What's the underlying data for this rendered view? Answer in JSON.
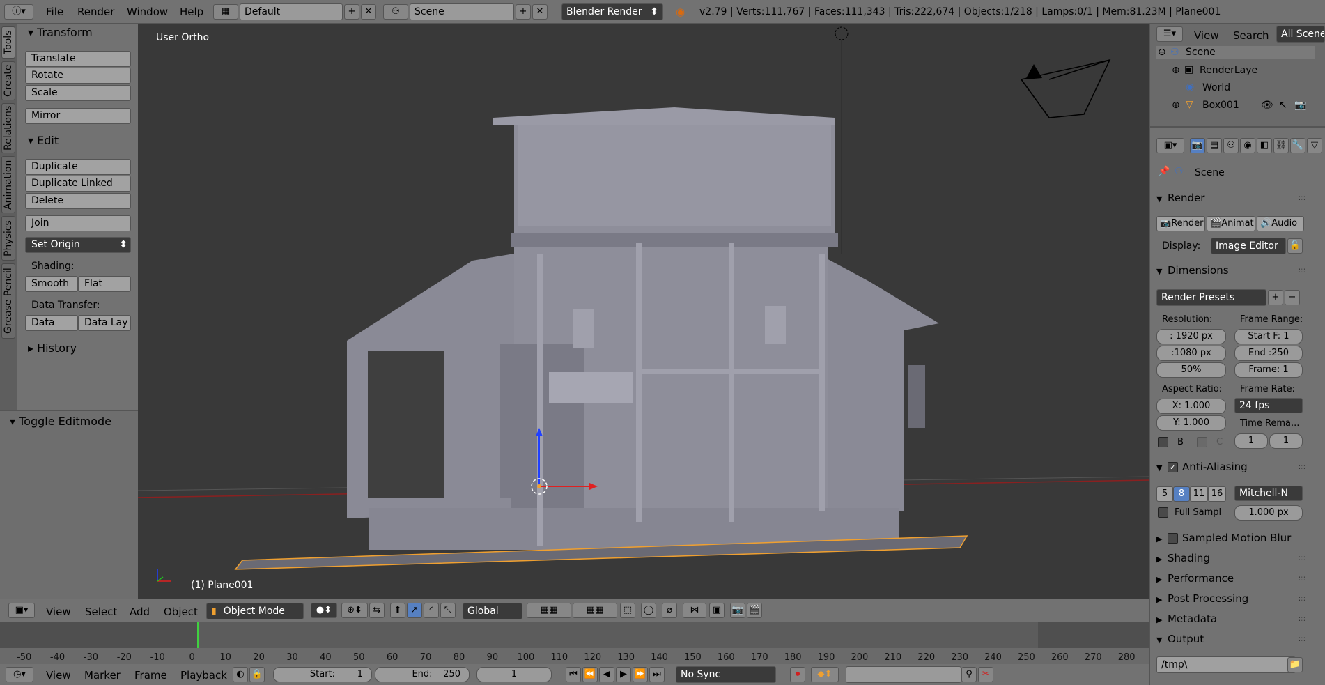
{
  "topbar": {
    "menus": [
      "File",
      "Render",
      "Window",
      "Help"
    ],
    "layout": "Default",
    "scene": "Scene",
    "engine": "Blender Render",
    "stats": "v2.79 | Verts:111,767 | Faces:111,343 | Tris:222,674 | Objects:1/218 | Lamps:0/1 | Mem:81.23M | Plane001"
  },
  "toolshelf": {
    "tabs": [
      "Tools",
      "Create",
      "Relations",
      "Animation",
      "Physics",
      "Grease Pencil"
    ],
    "transform_title": "Transform",
    "translate": "Translate",
    "rotate": "Rotate",
    "scale": "Scale",
    "mirror": "Mirror",
    "edit_title": "Edit",
    "duplicate": "Duplicate",
    "duplicate_linked": "Duplicate Linked",
    "delete": "Delete",
    "join": "Join",
    "set_origin": "Set Origin",
    "shading_label": "Shading:",
    "smooth": "Smooth",
    "flat": "Flat",
    "data_transfer_label": "Data Transfer:",
    "data": "Data",
    "data_lay": "Data Lay",
    "history_title": "History",
    "toggle_editmode": "Toggle Editmode"
  },
  "viewport": {
    "view_label": "User Ortho",
    "object_label": "(1) Plane001"
  },
  "view_header": {
    "view": "View",
    "select": "Select",
    "add": "Add",
    "object": "Object",
    "mode": "Object Mode",
    "orientation": "Global"
  },
  "timeline": {
    "ticks": [
      "-50",
      "-40",
      "-30",
      "-20",
      "-10",
      "0",
      "10",
      "20",
      "30",
      "40",
      "50",
      "60",
      "70",
      "80",
      "90",
      "100",
      "110",
      "120",
      "130",
      "140",
      "150",
      "160",
      "170",
      "180",
      "190",
      "200",
      "210",
      "220",
      "230",
      "240",
      "250",
      "260",
      "270",
      "280"
    ],
    "view": "View",
    "marker": "Marker",
    "frame": "Frame",
    "playback": "Playback",
    "start_label": "Start:",
    "start_value": "1",
    "end_label": "End:",
    "end_value": "250",
    "current_frame": "1",
    "sync": "No Sync"
  },
  "outliner": {
    "view": "View",
    "search": "Search",
    "filter": "All Scenes",
    "items": [
      "Scene",
      "RenderLaye",
      "World",
      "Box001"
    ]
  },
  "properties": {
    "scene_name": "Scene",
    "render_title": "Render",
    "render_btn": "Render",
    "animation_btn": "Animat",
    "audio_btn": "Audio",
    "display_label": "Display:",
    "display_value": "Image Editor",
    "dimensions_title": "Dimensions",
    "render_presets": "Render Presets",
    "resolution_label": "Resolution:",
    "res_x": ": 1920 px",
    "res_y": ":1080 px",
    "res_pct": "50%",
    "frame_range_label": "Frame Range:",
    "start_frame": "Start F: 1",
    "end_frame": "End :250",
    "frame_step": "Frame: 1",
    "aspect_label": "Aspect Ratio:",
    "aspect_x": "X:  1.000",
    "aspect_y": "Y:  1.000",
    "frame_rate_label": "Frame Rate:",
    "fps": "24 fps",
    "time_remap_label": "Time Rema...",
    "remap_old": "1",
    "remap_new": "1",
    "border_b": "B",
    "border_c": "C",
    "aa_title": "Anti-Aliasing",
    "aa_samples": [
      "5",
      "8",
      "11",
      "16"
    ],
    "aa_filter": "Mitchell-N",
    "full_sample": "Full Sampl",
    "filter_size": "1.000 px",
    "motion_blur_title": "Sampled Motion Blur",
    "shading_title": "Shading",
    "performance_title": "Performance",
    "post_processing_title": "Post Processing",
    "metadata_title": "Metadata",
    "output_title": "Output",
    "output_path": "/tmp\\"
  },
  "colors": {
    "accent_blue": "#5680c2",
    "selection_orange": "#f0a030",
    "header_grey": "#727272",
    "viewport_bg": "#393939"
  }
}
